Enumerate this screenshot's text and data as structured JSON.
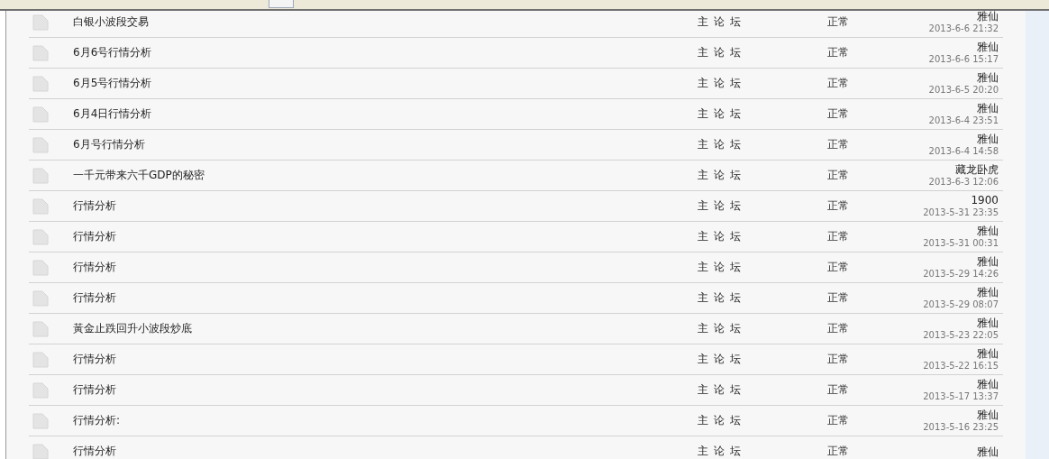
{
  "threads": [
    {
      "title": "白银小波段交易",
      "forum": "主 论 坛",
      "status": "正常",
      "author": "雅仙",
      "time": "2013-6-6 21:32"
    },
    {
      "title": "6月6号行情分析",
      "forum": "主 论 坛",
      "status": "正常",
      "author": "雅仙",
      "time": "2013-6-6 15:17"
    },
    {
      "title": "6月5号行情分析",
      "forum": "主 论 坛",
      "status": "正常",
      "author": "雅仙",
      "time": "2013-6-5 20:20"
    },
    {
      "title": "6月4日行情分析",
      "forum": "主 论 坛",
      "status": "正常",
      "author": "雅仙",
      "time": "2013-6-4 23:51"
    },
    {
      "title": "6月号行情分析",
      "forum": "主 论 坛",
      "status": "正常",
      "author": "雅仙",
      "time": "2013-6-4 14:58"
    },
    {
      "title": "一千元带来六千GDP的秘密",
      "forum": "主 论 坛",
      "status": "正常",
      "author": "藏龙卧虎",
      "time": "2013-6-3 12:06"
    },
    {
      "title": "行情分析",
      "forum": "主 论 坛",
      "status": "正常",
      "author": "1900",
      "time": "2013-5-31 23:35"
    },
    {
      "title": "行情分析",
      "forum": "主 论 坛",
      "status": "正常",
      "author": "雅仙",
      "time": "2013-5-31 00:31"
    },
    {
      "title": "行情分析",
      "forum": "主 论 坛",
      "status": "正常",
      "author": "雅仙",
      "time": "2013-5-29 14:26"
    },
    {
      "title": "行情分析",
      "forum": "主 论 坛",
      "status": "正常",
      "author": "雅仙",
      "time": "2013-5-29 08:07"
    },
    {
      "title": "黃金止跌回升小波段炒底",
      "forum": "主 论 坛",
      "status": "正常",
      "author": "雅仙",
      "time": "2013-5-23 22:05"
    },
    {
      "title": "行情分析",
      "forum": "主 论 坛",
      "status": "正常",
      "author": "雅仙",
      "time": "2013-5-22 16:15"
    },
    {
      "title": "行情分析",
      "forum": "主 论 坛",
      "status": "正常",
      "author": "雅仙",
      "time": "2013-5-17 13:37"
    },
    {
      "title": "行情分析:",
      "forum": "主 论 坛",
      "status": "正常",
      "author": "雅仙",
      "time": "2013-5-16 23:25"
    },
    {
      "title": "行情分析",
      "forum": "主 论 坛",
      "status": "正常",
      "author": "雅仙"
    }
  ]
}
